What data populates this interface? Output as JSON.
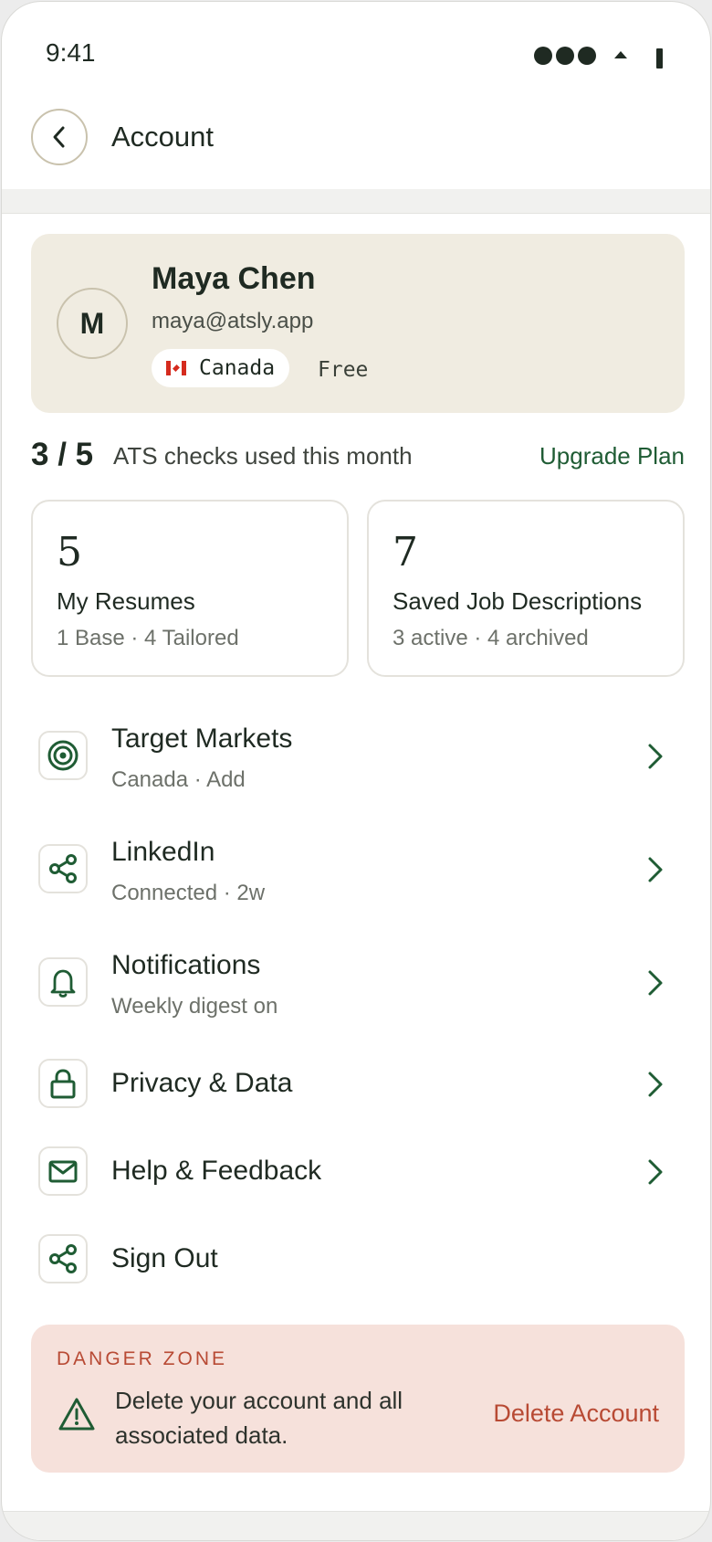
{
  "status_bar": {
    "time": "9:41"
  },
  "header": {
    "title": "Account",
    "back_icon": "chevron-left-icon"
  },
  "profile": {
    "avatar_initial": "M",
    "name": "Maya Chen",
    "email": "maya@atsly.app",
    "country": "Canada",
    "country_flag": "canada-flag-icon",
    "plan": "Free"
  },
  "usage": {
    "count": "3 / 5",
    "text": "ATS checks used this month",
    "upgrade_label": "Upgrade Plan",
    "used": 3,
    "limit": 5
  },
  "stats": [
    {
      "value": "5",
      "label": "My Resumes",
      "sub": "1 Base · 4 Tailored"
    },
    {
      "value": "7",
      "label": "Saved Job Descriptions",
      "sub": "3 active · 4 archived"
    }
  ],
  "menu": [
    {
      "icon": "target-icon",
      "title": "Target Markets",
      "sub": "Canada · Add"
    },
    {
      "icon": "share-icon",
      "title": "LinkedIn",
      "sub": "Connected · 2w"
    },
    {
      "icon": "bell-icon",
      "title": "Notifications",
      "sub": "Weekly digest on"
    },
    {
      "icon": "lock-icon",
      "title": "Privacy & Data"
    },
    {
      "icon": "mail-icon",
      "title": "Help & Feedback"
    },
    {
      "icon": "share-icon",
      "title": "Sign Out"
    }
  ],
  "danger_zone": {
    "label": "DANGER ZONE",
    "text": "Delete your account and all associated data.",
    "button_label": "Delete Account",
    "icon": "warning-icon"
  },
  "colors": {
    "accent": "#1f5c34",
    "profile_bg": "#f0ece1",
    "danger_bg": "#f6e1db",
    "danger_text": "#b84a34"
  }
}
